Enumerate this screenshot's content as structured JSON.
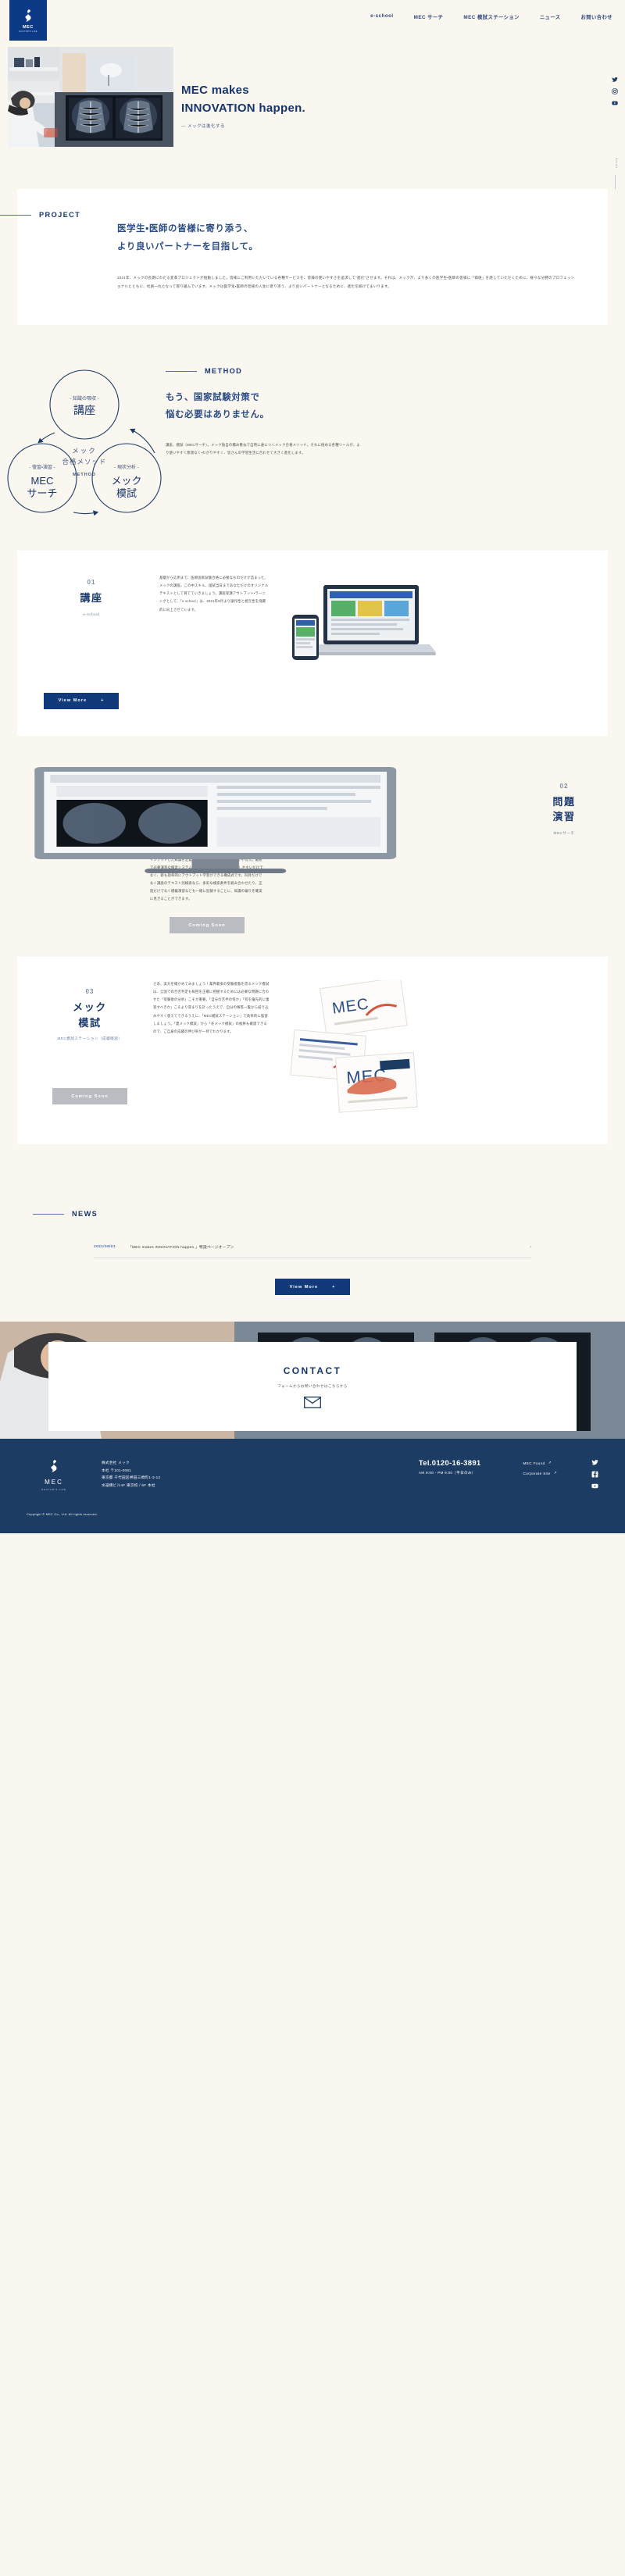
{
  "header": {
    "logo": {
      "text": "MEC",
      "sub": "DOCTOR'S LIFE",
      "icon": "mec-flame-logo"
    },
    "nav": [
      {
        "label": "e-school"
      },
      {
        "label": "MEC サーチ"
      },
      {
        "label": "MEC 模試ステーション"
      },
      {
        "label": "ニュース"
      },
      {
        "label": "お問い合わせ"
      }
    ]
  },
  "hero": {
    "title_line1": "MEC makes",
    "title_line2": "INNOVATION happen.",
    "subtitle": "— メックは進化する",
    "scroll_label": "Scroll",
    "social": [
      "twitter-icon",
      "instagram-icon",
      "youtube-icon"
    ]
  },
  "project": {
    "label": "PROJECT",
    "heading_line1": "医学生・医師の皆様に寄り添う、",
    "heading_line2": "より良いパートナーを目指して。",
    "body": "2021年、メックの長期にわたる変革プロジェクトが始動しました。皆様にご利用いただいている各種サービスを、皆様の使いやすさを追求して\"進化\"させます。それは、メックが、より多くの医学生・医師の皆様に「価値」を感じていただくために、様々な分野のプロフェッショナルとともに、社員一丸となって取り組んでいます。メックは医学生・医師の皆様の人生に寄り添う、より良いパートナーとなるために、進化を続けてまいります。"
  },
  "method": {
    "label": "METHOD",
    "heading_line1": "もう、国家試験対策で",
    "heading_line2": "悩む必要はありません。",
    "body": "講座、模試（MECサーチ）。メック独自の積み重ねで自然に身につくメック合格メソッド。それに挑める各種ツールが、より使いやすく無理なく・わかりやすく、皆さんの学習生活に合わせて大きく進化します。",
    "center_line1": "メック",
    "center_line2": "合格メソッド",
    "center_sub": "METHOD",
    "nodes": [
      {
        "kicker": "- 知識の吸収 -",
        "label": "講座"
      },
      {
        "kicker": "- 復習・演習 -",
        "label_line1": "MEC",
        "label_line2": "サーチ"
      },
      {
        "kicker": "- 現状分析 -",
        "label_line1": "メック",
        "label_line2": "模試"
      }
    ]
  },
  "features": [
    {
      "num": "01",
      "title": "講座",
      "tag": "e-school",
      "body": "基礎から応用まで、医師国家試験合格に必要なものだけが詰まった、メックの講座。この中スキル、国試当日まであなただけのオリジナルテキストとして育てていきましょう。講座受講アウトプット・ラーニングとして、「e-school」は、2021年9月より操作性と相互性を飛躍的に向上させています。",
      "button": "View More"
    },
    {
      "num": "02",
      "title_line1": "問題",
      "title_line2": "演習",
      "tag": "MECサーチ",
      "body": "インプットした知識を定着させるためには、復習と反復が不可欠。最短で必要演習な検索システム「MECサーチ」は、ただ検索しやすいだけでなく、新も効率的にアウトプット学習ができる構成式です。科目だけでなく講座のテキスト別検索なら、多彩な検索条件を組み合わせたり、正読だけでなく模擬演習なども一緒に記録することに、知識の偏りを確実に見きることができます。",
      "button": "Coming Soon"
    },
    {
      "num": "03",
      "title_line1": "メック",
      "title_line2": "模試",
      "tag": "MEC模試ステーション（成績確認）",
      "body": "さあ、実力を確かめてみましょう！業界最多の受験者数を誇るメック模試は、全国での合否判定も毎回を正確に把握するためには必要な問題に合わせた「受験後の分析」こそが重要。「自分の苦手の何か」「何を優先的に復習すべきか」こそより深まりを計ったうえで、自分の解答一覧から絞り込みやすく使えてできるうえに、「MEC模試ステーション」で効率的に復習しましょう。「夏メック模試」から「冬メック模試」の推移も確認できるので、ご自身の成績の伸び率が一目でわかります。",
      "button": "Coming Soon"
    }
  ],
  "news": {
    "label": "NEWS",
    "items": [
      {
        "date": "2021/09/01",
        "title": "「MEC makes INNOVATION happen.」特設ページオープン"
      }
    ],
    "button": "View More"
  },
  "contact": {
    "heading": "CONTACT",
    "text": "フォームからお問い合わせはこちらから",
    "icon": "mail-icon"
  },
  "footer": {
    "logo": {
      "text": "MEC",
      "sub": "DOCTOR'S LIFE"
    },
    "company": "株式会社 メック",
    "address_line1": "本社 〒101-0061",
    "address_line2": "東京都 千代田区神田三崎町1-3-12",
    "address_line3": "水道橋ビル4F 東京校 / 6F 本社",
    "tel": "Tel.0120-16-3891",
    "hours": "AM 9:00 - PM 6:00（平日のみ）",
    "links": [
      {
        "label": "MEC Found"
      },
      {
        "label": "Corporate Site"
      }
    ],
    "social": [
      "twitter-icon",
      "facebook-icon",
      "youtube-icon"
    ],
    "copyright": "Copyright © MEC Co., Ltd. All rights reserved."
  },
  "colors": {
    "navy": "#1d3c63",
    "deep_navy": "#0d3a86",
    "cream": "#faf6f0",
    "accent": "#123a7a"
  }
}
